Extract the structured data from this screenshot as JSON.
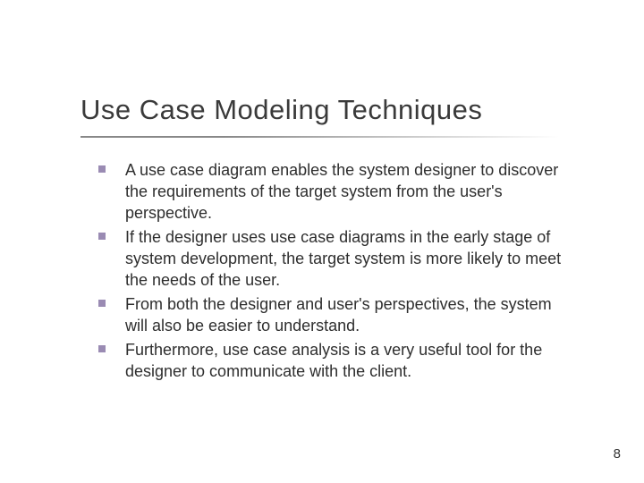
{
  "title": "Use Case Modeling Techniques",
  "bullets": [
    "A use case diagram enables the system designer to discover the requirements of the target system from the user's perspective.",
    "If the designer uses use case diagrams in the early stage of system development, the target system is more likely to meet the needs of the user.",
    "From both the designer and user's perspectives, the system will also be easier to understand.",
    "Furthermore, use case analysis is a very useful tool for the designer to communicate with the client."
  ],
  "page_number": "8"
}
